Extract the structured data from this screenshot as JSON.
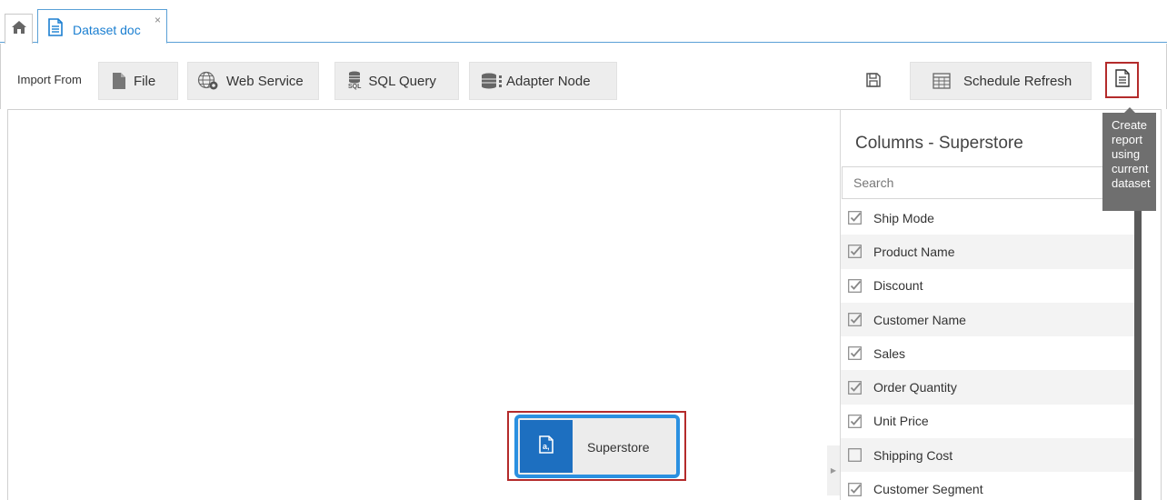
{
  "tabs": {
    "home_icon": "home-icon",
    "active_tab": {
      "label": "Dataset doc",
      "icon": "document-icon",
      "close": "×"
    }
  },
  "toolbar": {
    "import_label": "Import From",
    "file_label": "File",
    "web_service_label": "Web Service",
    "sql_query_label": "SQL Query",
    "sql_icon_text": "SQL",
    "adapter_node_label": "Adapter Node",
    "schedule_refresh_label": "Schedule Refresh"
  },
  "tooltip": {
    "text": "Create report using current dataset"
  },
  "node": {
    "label": "Superstore",
    "icon": "csv-file-icon"
  },
  "columns_panel": {
    "title": "Columns - Superstore",
    "search_placeholder": "Search",
    "columns": [
      {
        "name": "Ship Mode",
        "checked": true
      },
      {
        "name": "Product Name",
        "checked": true
      },
      {
        "name": "Discount",
        "checked": true
      },
      {
        "name": "Customer Name",
        "checked": true
      },
      {
        "name": "Sales",
        "checked": true
      },
      {
        "name": "Order Quantity",
        "checked": true
      },
      {
        "name": "Unit Price",
        "checked": true
      },
      {
        "name": "Shipping Cost",
        "checked": false
      },
      {
        "name": "Customer Segment",
        "checked": true
      }
    ]
  },
  "colors": {
    "accent": "#1b7fd1",
    "node_border": "#2b90e0",
    "node_icon_bg": "#1d6fc0",
    "highlight_red": "#b42b2b",
    "tooltip_bg": "#6f6f6f"
  }
}
